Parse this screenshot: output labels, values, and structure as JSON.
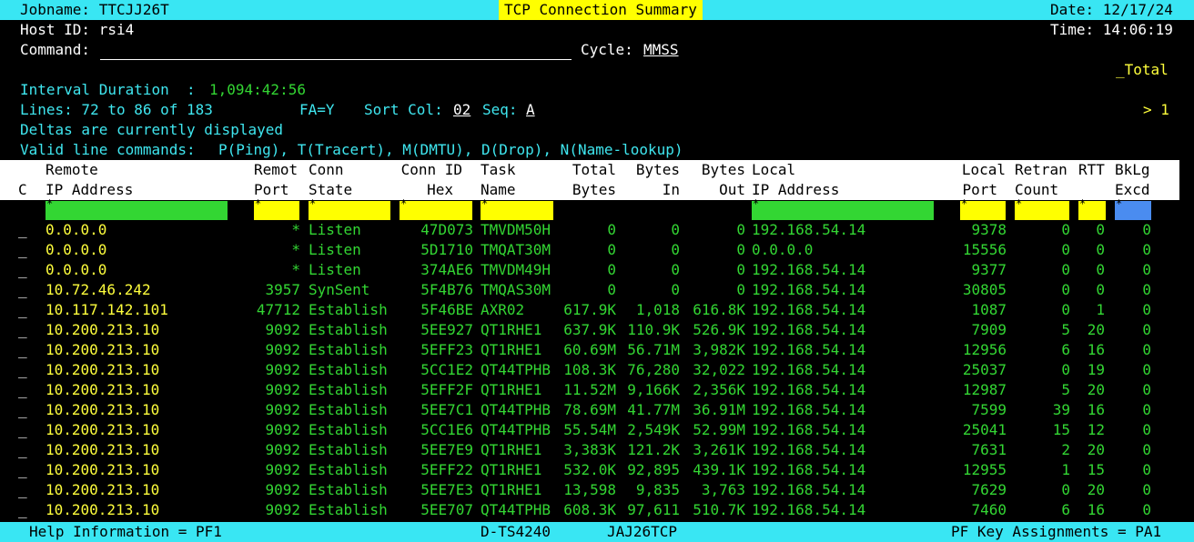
{
  "header": {
    "jobname": "Jobname: TTCJJ26T",
    "title": "TCP Connection Summary",
    "date": "Date: 12/17/24",
    "host_id": "Host ID: rsi4",
    "time": "Time: 14:06:19",
    "command_label": "Command:",
    "cycle_label": "Cycle:",
    "cycle_value": "MMSS",
    "total_label": "_Total",
    "interval_label": "Interval Duration  :",
    "interval_value": "1,094:42:56",
    "lines": "Lines: 72 to 86 of 183",
    "fa": "FA=Y",
    "sort_label": "Sort Col:",
    "sort_value": "02",
    "seq_label": "Seq:",
    "seq_value": "A",
    "scroll_indicator": "> 1",
    "deltas_msg": "Deltas are currently displayed",
    "valid_label": "Valid line commands:",
    "valid_cmds": "P(Ping), T(Tracert), M(DMTU), D(Drop), N(Name-lookup)"
  },
  "columns": {
    "c": [
      "",
      "C"
    ],
    "remote_ip": [
      "Remote",
      "IP Address"
    ],
    "remote_port": [
      "Remot",
      "Port"
    ],
    "conn_state": [
      "Conn",
      "State"
    ],
    "conn_id": [
      "Conn ID",
      "Hex"
    ],
    "task": [
      "Task",
      "Name"
    ],
    "total_bytes": [
      "Total",
      "Bytes"
    ],
    "bytes_in": [
      "Bytes",
      "In"
    ],
    "bytes_out": [
      "Bytes",
      "Out"
    ],
    "local_ip": [
      "Local",
      "IP Address"
    ],
    "local_port": [
      "Local",
      "Port"
    ],
    "retran": [
      "Retran",
      "Count"
    ],
    "rtt": [
      "RTT",
      ""
    ],
    "bklg": [
      "BkLg",
      "Excd"
    ]
  },
  "filter_star": "*",
  "rows": [
    {
      "cmd": "_",
      "remote_ip": "0.0.0.0",
      "remote_port": "*",
      "state": "Listen",
      "conn_id": "47D073",
      "task": "TMVDM50H",
      "total": "0",
      "in": "0",
      "out": "0",
      "local_ip": "192.168.54.14",
      "local_port": "9378",
      "retran": "0",
      "rtt": "0",
      "bklg": "0"
    },
    {
      "cmd": "_",
      "remote_ip": "0.0.0.0",
      "remote_port": "*",
      "state": "Listen",
      "conn_id": "5D1710",
      "task": "TMQAT30M",
      "total": "0",
      "in": "0",
      "out": "0",
      "local_ip": "0.0.0.0",
      "local_port": "15556",
      "retran": "0",
      "rtt": "0",
      "bklg": "0"
    },
    {
      "cmd": "_",
      "remote_ip": "0.0.0.0",
      "remote_port": "*",
      "state": "Listen",
      "conn_id": "374AE6",
      "task": "TMVDM49H",
      "total": "0",
      "in": "0",
      "out": "0",
      "local_ip": "192.168.54.14",
      "local_port": "9377",
      "retran": "0",
      "rtt": "0",
      "bklg": "0"
    },
    {
      "cmd": "_",
      "remote_ip": "10.72.46.242",
      "remote_port": "3957",
      "state": "SynSent",
      "conn_id": "5F4B76",
      "task": "TMQAS30M",
      "total": "0",
      "in": "0",
      "out": "0",
      "local_ip": "192.168.54.14",
      "local_port": "30805",
      "retran": "0",
      "rtt": "0",
      "bklg": "0"
    },
    {
      "cmd": "_",
      "remote_ip": "10.117.142.101",
      "remote_port": "47712",
      "state": "Establish",
      "conn_id": "5F46BE",
      "task": "AXR02",
      "total": "617.9K",
      "in": "1,018",
      "out": "616.8K",
      "local_ip": "192.168.54.14",
      "local_port": "1087",
      "retran": "0",
      "rtt": "1",
      "bklg": "0"
    },
    {
      "cmd": "_",
      "remote_ip": "10.200.213.10",
      "remote_port": "9092",
      "state": "Establish",
      "conn_id": "5EE927",
      "task": "QT1RHE1",
      "total": "637.9K",
      "in": "110.9K",
      "out": "526.9K",
      "local_ip": "192.168.54.14",
      "local_port": "7909",
      "retran": "5",
      "rtt": "20",
      "bklg": "0"
    },
    {
      "cmd": "_",
      "remote_ip": "10.200.213.10",
      "remote_port": "9092",
      "state": "Establish",
      "conn_id": "5EFF23",
      "task": "QT1RHE1",
      "total": "60.69M",
      "in": "56.71M",
      "out": "3,982K",
      "local_ip": "192.168.54.14",
      "local_port": "12956",
      "retran": "6",
      "rtt": "16",
      "bklg": "0"
    },
    {
      "cmd": "_",
      "remote_ip": "10.200.213.10",
      "remote_port": "9092",
      "state": "Establish",
      "conn_id": "5CC1E2",
      "task": "QT44TPHB",
      "total": "108.3K",
      "in": "76,280",
      "out": "32,022",
      "local_ip": "192.168.54.14",
      "local_port": "25037",
      "retran": "0",
      "rtt": "19",
      "bklg": "0"
    },
    {
      "cmd": "_",
      "remote_ip": "10.200.213.10",
      "remote_port": "9092",
      "state": "Establish",
      "conn_id": "5EFF2F",
      "task": "QT1RHE1",
      "total": "11.52M",
      "in": "9,166K",
      "out": "2,356K",
      "local_ip": "192.168.54.14",
      "local_port": "12987",
      "retran": "5",
      "rtt": "20",
      "bklg": "0"
    },
    {
      "cmd": "_",
      "remote_ip": "10.200.213.10",
      "remote_port": "9092",
      "state": "Establish",
      "conn_id": "5EE7C1",
      "task": "QT44TPHB",
      "total": "78.69M",
      "in": "41.77M",
      "out": "36.91M",
      "local_ip": "192.168.54.14",
      "local_port": "7599",
      "retran": "39",
      "rtt": "16",
      "bklg": "0"
    },
    {
      "cmd": "_",
      "remote_ip": "10.200.213.10",
      "remote_port": "9092",
      "state": "Establish",
      "conn_id": "5CC1E6",
      "task": "QT44TPHB",
      "total": "55.54M",
      "in": "2,549K",
      "out": "52.99M",
      "local_ip": "192.168.54.14",
      "local_port": "25041",
      "retran": "15",
      "rtt": "12",
      "bklg": "0"
    },
    {
      "cmd": "_",
      "remote_ip": "10.200.213.10",
      "remote_port": "9092",
      "state": "Establish",
      "conn_id": "5EE7E9",
      "task": "QT1RHE1",
      "total": "3,383K",
      "in": "121.2K",
      "out": "3,261K",
      "local_ip": "192.168.54.14",
      "local_port": "7631",
      "retran": "2",
      "rtt": "20",
      "bklg": "0"
    },
    {
      "cmd": "_",
      "remote_ip": "10.200.213.10",
      "remote_port": "9092",
      "state": "Establish",
      "conn_id": "5EFF22",
      "task": "QT1RHE1",
      "total": "532.0K",
      "in": "92,895",
      "out": "439.1K",
      "local_ip": "192.168.54.14",
      "local_port": "12955",
      "retran": "1",
      "rtt": "15",
      "bklg": "0"
    },
    {
      "cmd": "_",
      "remote_ip": "10.200.213.10",
      "remote_port": "9092",
      "state": "Establish",
      "conn_id": "5EE7E3",
      "task": "QT1RHE1",
      "total": "13,598",
      "in": "9,835",
      "out": "3,763",
      "local_ip": "192.168.54.14",
      "local_port": "7629",
      "retran": "0",
      "rtt": "20",
      "bklg": "0"
    },
    {
      "cmd": "_",
      "remote_ip": "10.200.213.10",
      "remote_port": "9092",
      "state": "Establish",
      "conn_id": "5EE707",
      "task": "QT44TPHB",
      "total": "608.3K",
      "in": "97,611",
      "out": "510.7K",
      "local_ip": "192.168.54.14",
      "local_port": "7460",
      "retran": "6",
      "rtt": "16",
      "bklg": "0"
    }
  ],
  "footer": {
    "help": "Help Information = PF1",
    "terminal": "D-TS4240",
    "job": "JAJ26TCP",
    "pf_keys": "PF Key Assignments = PA1"
  },
  "colors": {
    "bar_cyan": "#39e6f3",
    "title_yellow": "#ffff00",
    "value_green": "#33d633",
    "ip_yellow": "#ffff3c",
    "label_cyan": "#3fe6ef",
    "filter_blue": "#4a8cf0"
  }
}
